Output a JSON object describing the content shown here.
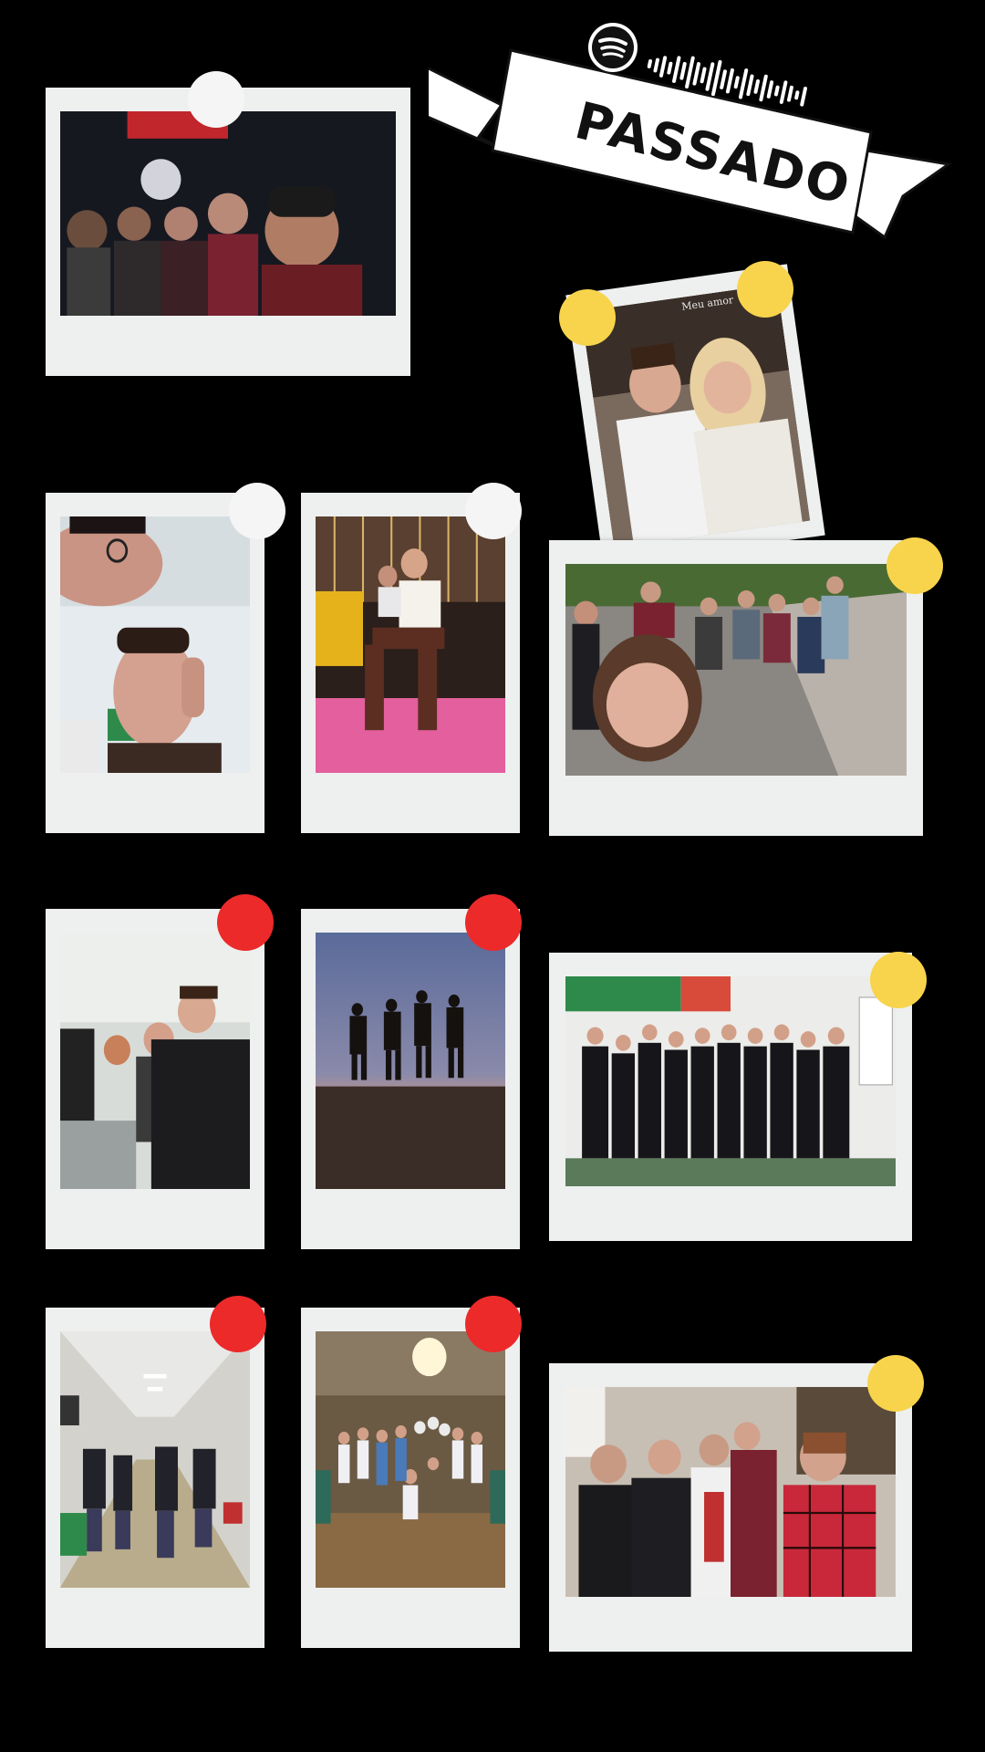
{
  "banner": {
    "title": "PASSADO",
    "logo": "spotify-logo-icon",
    "code": "spotify-scan-code"
  },
  "photos": [
    {
      "id": 1,
      "pin": "white",
      "scene": "night-group-selfie"
    },
    {
      "id": 2,
      "pin": "yellow",
      "caption": "Meu amor",
      "scene": "couple-selfie"
    },
    {
      "id": 3,
      "pin": "white",
      "scene": "classroom-selfie"
    },
    {
      "id": 4,
      "pin": "white",
      "scene": "fair-ride"
    },
    {
      "id": 5,
      "pin": "yellow",
      "scene": "courtyard-group"
    },
    {
      "id": 6,
      "pin": "red",
      "scene": "computer-lab"
    },
    {
      "id": 7,
      "pin": "red",
      "scene": "sunset-silhouettes"
    },
    {
      "id": 8,
      "pin": "yellow",
      "scene": "class-photo-jackets"
    },
    {
      "id": 9,
      "pin": "red",
      "scene": "school-hallway"
    },
    {
      "id": 10,
      "pin": "red",
      "scene": "party-group"
    },
    {
      "id": 11,
      "pin": "yellow",
      "scene": "friends-group"
    }
  ],
  "colors": {
    "background": "#000000",
    "frame": "#eef0ef",
    "pin_white": "#f4f5f4",
    "pin_yellow": "#f8d44c",
    "pin_red": "#ec2a2a"
  }
}
